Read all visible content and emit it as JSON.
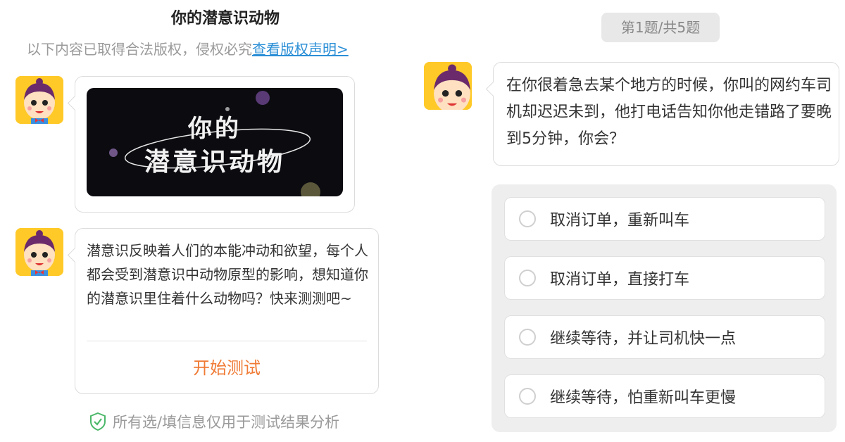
{
  "header": {
    "title": "你的潜意识动物",
    "notice_text": "以下内容已取得合法版权，侵权必究",
    "notice_link": "查看版权声明>"
  },
  "intro": {
    "banner_line1": "你的",
    "banner_line2": "潜意识动物",
    "description": "潜意识反映着人们的本能冲动和欲望，每个人都会受到潜意识中动物原型的影响，想知道你的潜意识里住着什么动物吗？快来测测吧~",
    "start_label": "开始测试"
  },
  "privacy": {
    "text": "所有选/填信息仅用于测试结果分析"
  },
  "quiz": {
    "counter": "第1题/共5题",
    "question": "在你很着急去某个地方的时候，你叫的网约车司机却迟迟未到，他打电话告知你他走错路了要晚到5分钟，你会？",
    "options": [
      "取消订单，重新叫车",
      "取消订单，直接打车",
      "继续等待，并让司机快一点",
      "继续等待，怕重新叫车更慢"
    ]
  },
  "colors": {
    "accent": "#f07b36",
    "link": "#2b8fd6",
    "avatar_bg": "#ffc928",
    "check": "#4cb86a"
  }
}
